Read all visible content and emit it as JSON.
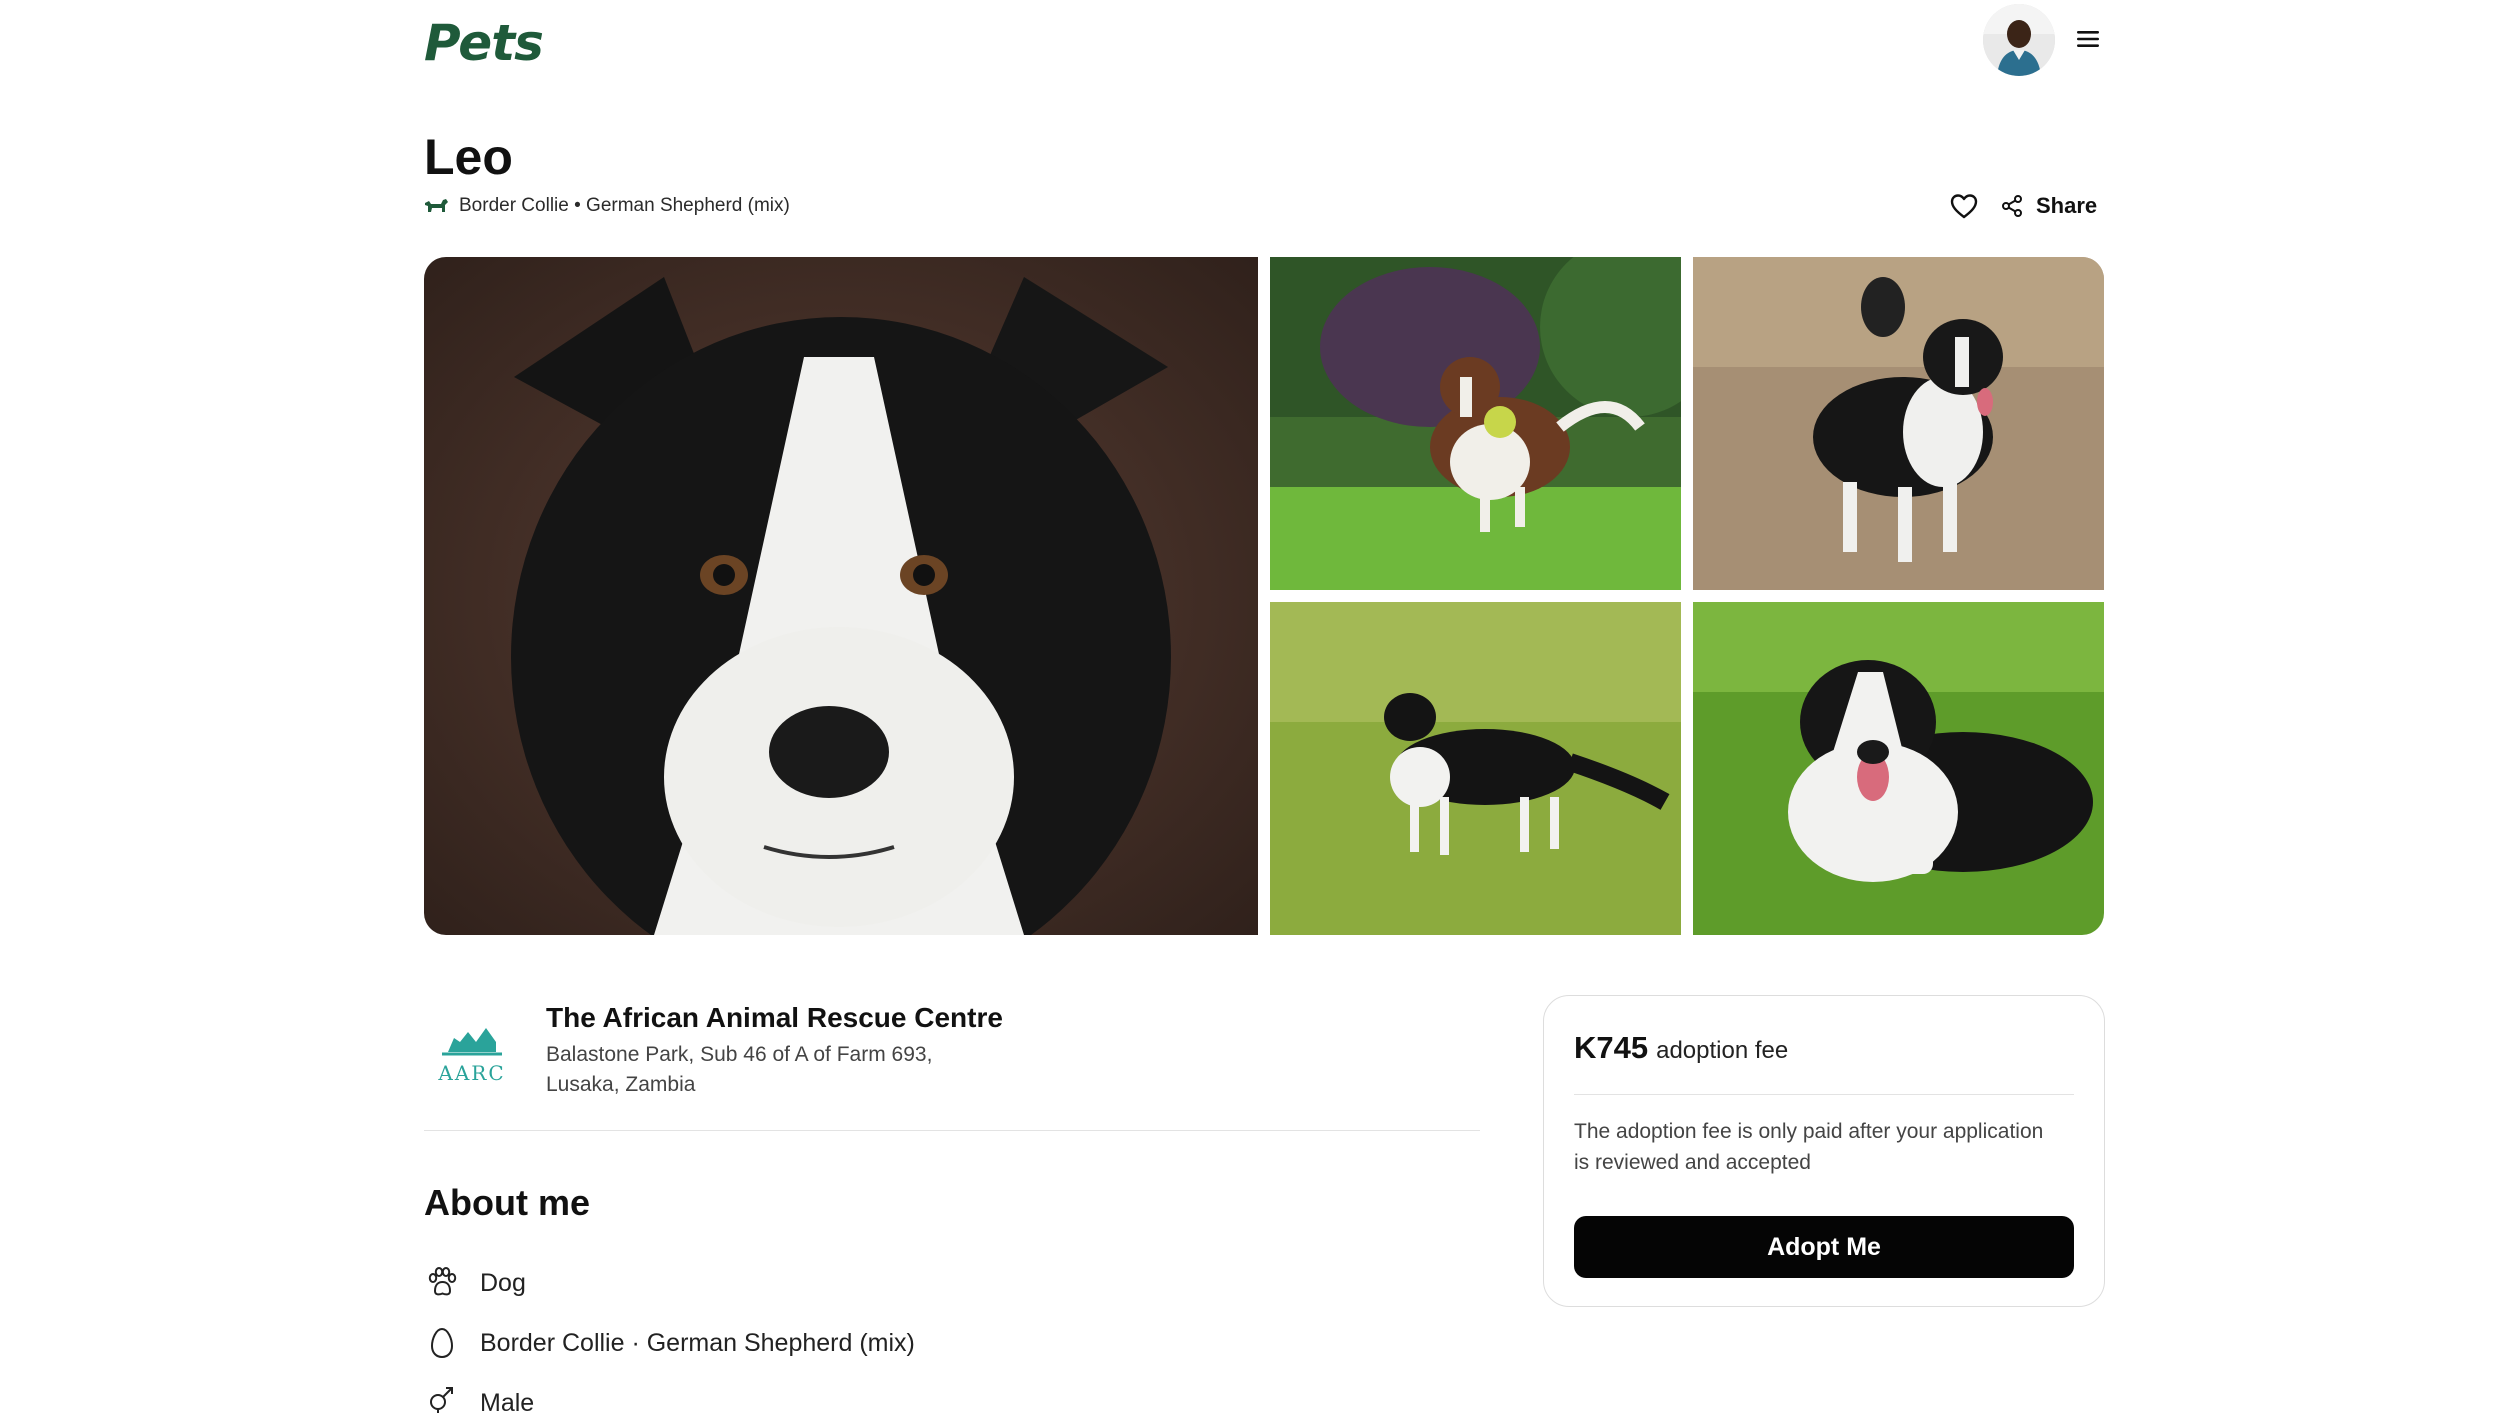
{
  "header": {
    "logo_text": "Pets",
    "avatar_alt": "User avatar",
    "menu_icon": "hamburger-menu-icon"
  },
  "pet": {
    "name": "Leo",
    "breed_line": "Border Collie • German Shepherd (mix)",
    "breed_icon": "dog-icon",
    "favorite_icon": "heart-icon",
    "share_label": "Share",
    "share_icon": "share-icon"
  },
  "gallery": {
    "photos": [
      "border-collie-closeup-photo",
      "brown-white-collie-with-ball-photo",
      "black-white-collie-on-dirt-photo",
      "collie-standing-on-grass-photo",
      "collie-lying-on-grass-photo"
    ]
  },
  "organization": {
    "name": "The African Animal Rescue Centre",
    "address_line1": "Balastone Park, Sub 46 of A of Farm 693,",
    "address_line2": "Lusaka, Zambia",
    "logo_text": "AARC"
  },
  "about": {
    "title": "About me",
    "attributes": [
      {
        "icon": "paw-icon",
        "text": "Dog"
      },
      {
        "icon": "egg-icon",
        "text": "Border Collie · German Shepherd (mix)"
      },
      {
        "icon": "gender-icon",
        "text": "Male"
      }
    ]
  },
  "fee_card": {
    "amount": "K745",
    "label": "adoption fee",
    "note": "The adoption fee is only paid after your application is reviewed and accepted",
    "button_label": "Adopt Me"
  },
  "colors": {
    "brand_green": "#1f5a3a",
    "org_teal": "#2aa39a",
    "button_bg": "#050505"
  }
}
